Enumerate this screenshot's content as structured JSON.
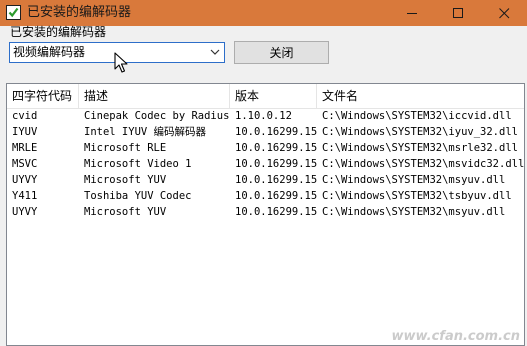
{
  "window": {
    "title": "已安装的编解码器",
    "colors": {
      "titlebar": "#d9793b",
      "client": "#f0f0f0",
      "select_border": "#2d6ec9"
    }
  },
  "controls": {
    "group_label": "已安装的编解码器",
    "select_value": "视频编解码器",
    "close_button": "关闭"
  },
  "list": {
    "columns": [
      "四字符代码",
      "描述",
      "版本",
      "文件名"
    ],
    "rows": [
      [
        "cvid",
        "Cinepak Codec by Radius",
        "1.10.0.12",
        "C:\\Windows\\SYSTEM32\\iccvid.dll"
      ],
      [
        "IYUV",
        "Intel IYUV 编码解码器",
        "10.0.16299.15",
        "C:\\Windows\\SYSTEM32\\iyuv_32.dll"
      ],
      [
        "MRLE",
        "Microsoft RLE",
        "10.0.16299.15",
        "C:\\Windows\\SYSTEM32\\msrle32.dll"
      ],
      [
        "MSVC",
        "Microsoft Video 1",
        "10.0.16299.15",
        "C:\\Windows\\SYSTEM32\\msvidc32.dll"
      ],
      [
        "UYVY",
        "Microsoft YUV",
        "10.0.16299.15",
        "C:\\Windows\\SYSTEM32\\msyuv.dll"
      ],
      [
        "Y411",
        "Toshiba YUV Codec",
        "10.0.16299.15",
        "C:\\Windows\\SYSTEM32\\tsbyuv.dll"
      ],
      [
        "UYVY",
        "Microsoft YUV",
        "10.0.16299.15",
        "C:\\Windows\\SYSTEM32\\msyuv.dll"
      ]
    ]
  },
  "watermark": "www.cfan.com.cn"
}
